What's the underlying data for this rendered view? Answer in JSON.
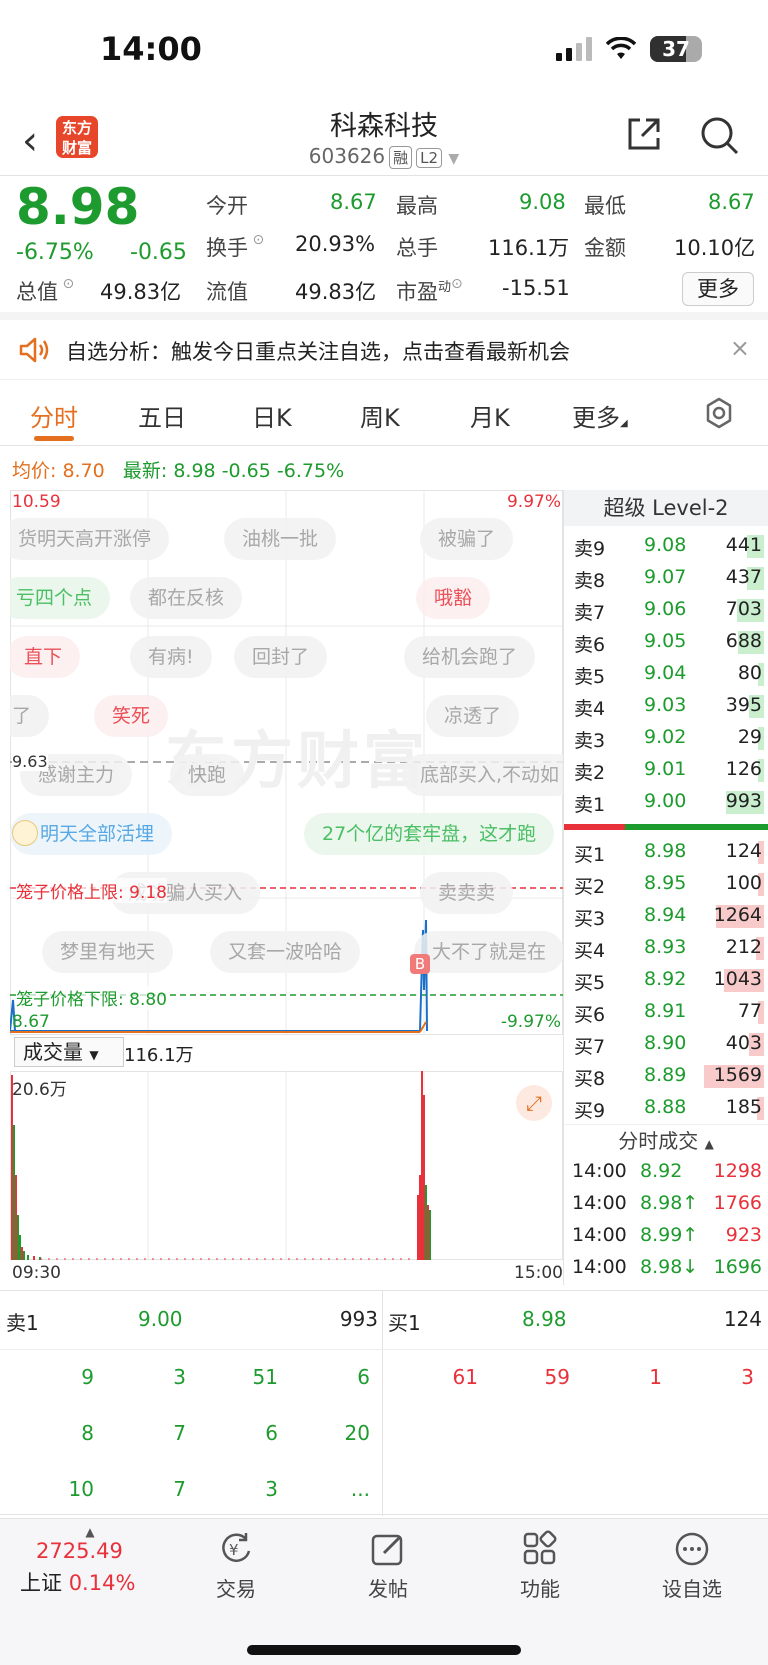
{
  "status": {
    "time": "14:00",
    "battery": "37"
  },
  "header": {
    "back": "‹",
    "logo": "东方财富",
    "title": "科森科技",
    "code": "603626",
    "tags": [
      "融",
      "L2"
    ]
  },
  "quote": {
    "price": "8.98",
    "chg_pct": "-6.75%",
    "chg": "-0.65",
    "cells": [
      {
        "label": "今开",
        "value": "8.67",
        "color": "g"
      },
      {
        "label": "最高",
        "value": "9.08",
        "color": "g"
      },
      {
        "label": "最低",
        "value": "8.67",
        "color": "g"
      },
      {
        "label": "换手",
        "value": "20.93%",
        "color": ""
      },
      {
        "label": "总手",
        "value": "116.1万",
        "color": ""
      },
      {
        "label": "金额",
        "value": "10.10亿",
        "color": ""
      },
      {
        "label": "总值",
        "value": "49.83亿",
        "color": ""
      },
      {
        "label": "流值",
        "value": "49.83亿",
        "color": ""
      },
      {
        "label": "市盈",
        "value": "-15.51",
        "color": ""
      }
    ],
    "more": "更多",
    "pe_sup": "动"
  },
  "notice": {
    "text": "自选分析：触发今日重点关注自选，点击查看最新机会",
    "close": "×"
  },
  "tabs": [
    "分时",
    "五日",
    "日K",
    "周K",
    "月K",
    "更多"
  ],
  "avg": {
    "label_avg": "均价:",
    "avg": "8.70",
    "label_latest": "最新:",
    "latest": "8.98",
    "chg": "-0.65",
    "pct": "-6.75%"
  },
  "chart": {
    "top_price": "10.59",
    "top_pct": "9.97%",
    "mid_price": "9.63",
    "bottom_price": "8.67",
    "bottom_pct": "-9.97%",
    "cage_up_label": "笼子价格上限: 9.18",
    "cage_down_label": "笼子价格下限: 8.80",
    "b_marker": "B",
    "watermark": "东方财富",
    "bubbles": [
      "货明天高开涨停",
      "油桃一批",
      "被骗了",
      "亏四个点",
      "都在反核",
      "哦豁",
      "直下",
      "有病!",
      "回封了",
      "给机会跑了",
      "了",
      "笑死",
      "凉透了",
      "感谢主力",
      "快跑",
      "底部买入,不动如",
      "明天全部活埋",
      "27个亿的套牢盘，这才跑",
      "成功骗人买入",
      "卖卖卖",
      "梦里有地天",
      "又套一波哈哈",
      "大不了就是在"
    ]
  },
  "volume": {
    "selector": "成交量",
    "total": "116.1万",
    "max": "20.6万",
    "start": "09:30",
    "end": "15:00"
  },
  "orderbook": {
    "title": "超级 Level-2",
    "asks": [
      {
        "l": "卖9",
        "p": "9.08",
        "v": "441"
      },
      {
        "l": "卖8",
        "p": "9.07",
        "v": "437"
      },
      {
        "l": "卖7",
        "p": "9.06",
        "v": "703"
      },
      {
        "l": "卖6",
        "p": "9.05",
        "v": "688"
      },
      {
        "l": "卖5",
        "p": "9.04",
        "v": "80"
      },
      {
        "l": "卖4",
        "p": "9.03",
        "v": "395"
      },
      {
        "l": "卖3",
        "p": "9.02",
        "v": "29"
      },
      {
        "l": "卖2",
        "p": "9.01",
        "v": "126"
      },
      {
        "l": "卖1",
        "p": "9.00",
        "v": "993"
      }
    ],
    "bids": [
      {
        "l": "买1",
        "p": "8.98",
        "v": "124"
      },
      {
        "l": "买2",
        "p": "8.95",
        "v": "100"
      },
      {
        "l": "买3",
        "p": "8.94",
        "v": "1264"
      },
      {
        "l": "买4",
        "p": "8.93",
        "v": "212"
      },
      {
        "l": "买5",
        "p": "8.92",
        "v": "1043"
      },
      {
        "l": "买6",
        "p": "8.91",
        "v": "77"
      },
      {
        "l": "买7",
        "p": "8.90",
        "v": "403"
      },
      {
        "l": "买8",
        "p": "8.89",
        "v": "1569"
      },
      {
        "l": "买9",
        "p": "8.88",
        "v": "185"
      }
    ],
    "trades_title": "分时成交",
    "trades": [
      {
        "t": "14:00",
        "p": "8.92",
        "v": "1298",
        "d": ""
      },
      {
        "t": "14:00",
        "p": "8.98↑",
        "v": "1766",
        "d": "r"
      },
      {
        "t": "14:00",
        "p": "8.99↑",
        "v": "923",
        "d": "r"
      },
      {
        "t": "14:00",
        "p": "8.98↓",
        "v": "1696",
        "d": "g"
      }
    ]
  },
  "queue": {
    "ask_label": "卖1",
    "ask_price": "9.00",
    "ask_vol": "993",
    "bid_label": "买1",
    "bid_price": "8.98",
    "bid_vol": "124",
    "ask_rows": [
      [
        "9",
        "3",
        "51",
        "6"
      ],
      [
        "8",
        "7",
        "6",
        "20"
      ],
      [
        "10",
        "7",
        "3",
        "..."
      ]
    ],
    "bid_rows": [
      [
        "61",
        "59",
        "1",
        "3"
      ]
    ]
  },
  "nav": {
    "index_value": "2725.49",
    "index_name": "上证",
    "index_pct": "0.14%",
    "items": [
      "交易",
      "发帖",
      "功能",
      "设自选"
    ]
  },
  "colors": {
    "up": "#e8313a",
    "down": "#1e9b2e",
    "accent": "#e36f1f"
  }
}
